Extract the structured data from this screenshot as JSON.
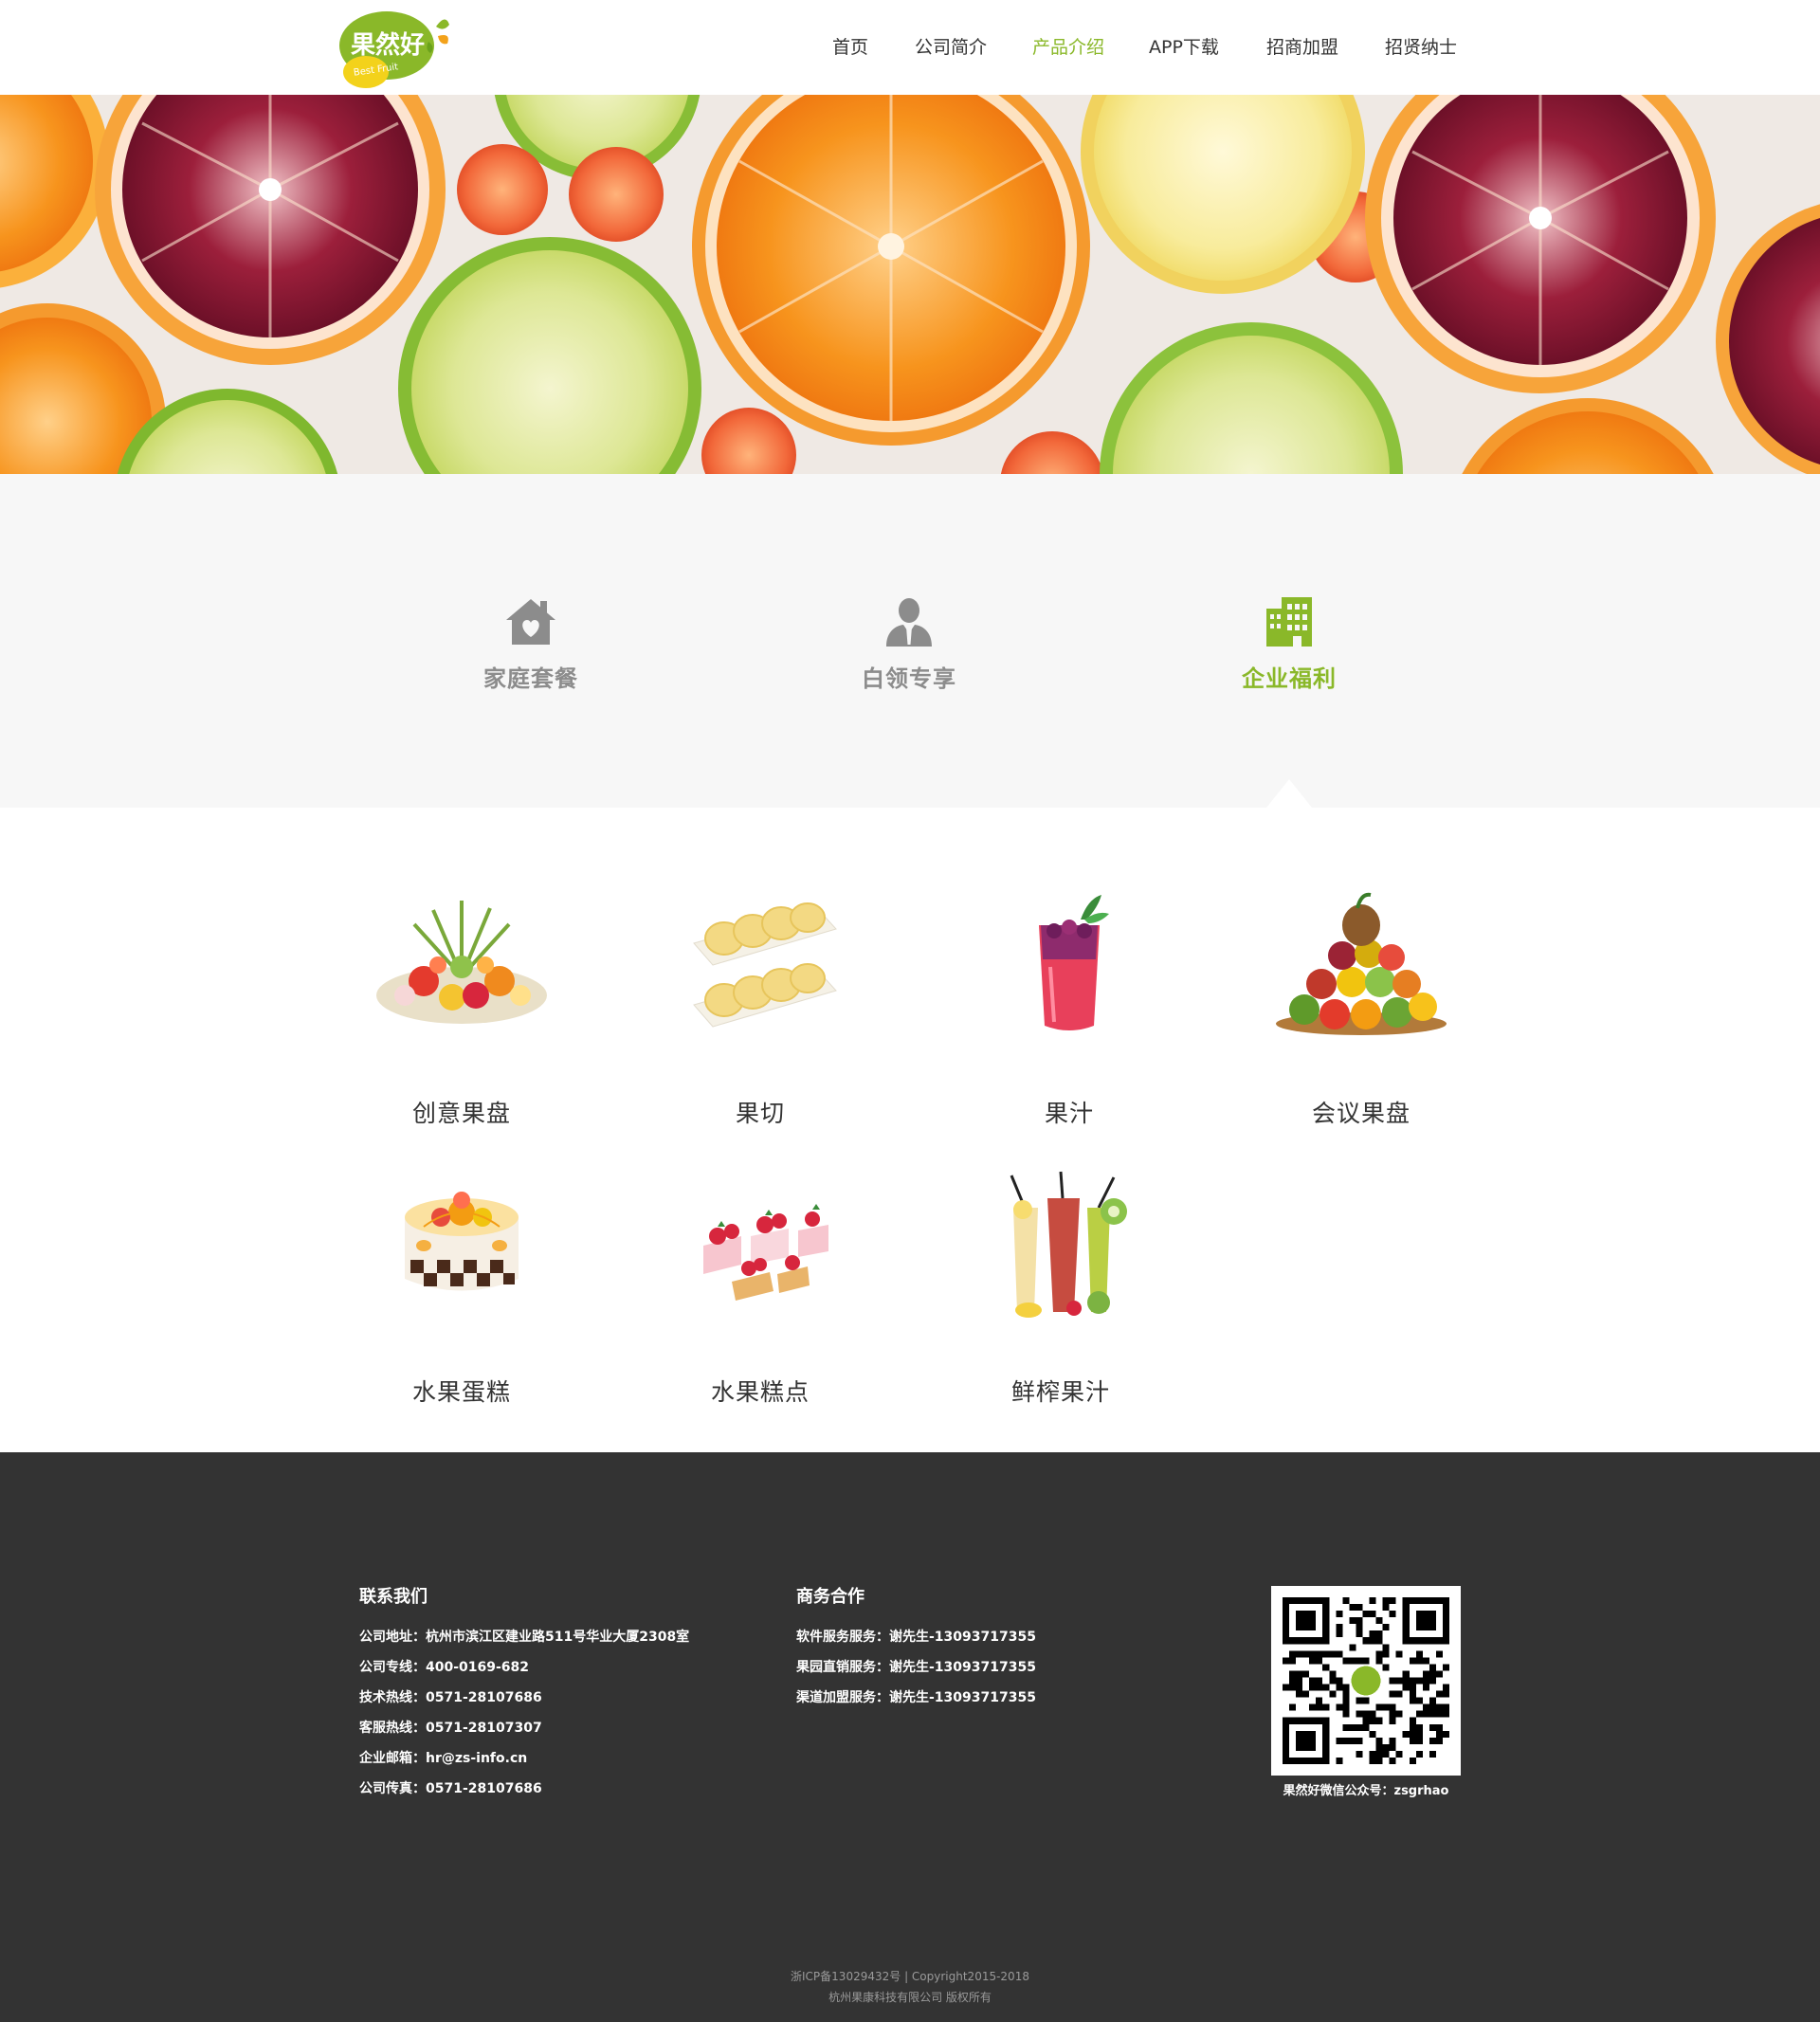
{
  "brand": {
    "logo_text": "果然好",
    "logo_sub": "Best Fruit",
    "accent_color": "#8ab829"
  },
  "nav": {
    "items": [
      {
        "label": "首页",
        "active": false
      },
      {
        "label": "公司简介",
        "active": false
      },
      {
        "label": "产品介绍",
        "active": true
      },
      {
        "label": "APP下载",
        "active": false
      },
      {
        "label": "招商加盟",
        "active": false
      },
      {
        "label": "招贤纳士",
        "active": false
      }
    ]
  },
  "categories": [
    {
      "label": "家庭套餐",
      "icon": "house-heart-icon",
      "active": false
    },
    {
      "label": "白领专享",
      "icon": "person-suit-icon",
      "active": false
    },
    {
      "label": "企业福利",
      "icon": "office-building-icon",
      "active": true
    }
  ],
  "products": [
    {
      "label": "创意果盘",
      "icon": "fruit-platter-icon"
    },
    {
      "label": "果切",
      "icon": "pomelo-slices-icon"
    },
    {
      "label": "果汁",
      "icon": "berry-juice-glass-icon"
    },
    {
      "label": "会议果盘",
      "icon": "fruit-pyramid-icon"
    },
    {
      "label": "水果蛋糕",
      "icon": "fruit-cake-icon"
    },
    {
      "label": "水果糕点",
      "icon": "fruit-pastries-icon"
    },
    {
      "label": "鲜榨果汁",
      "icon": "fresh-juices-icon"
    }
  ],
  "footer": {
    "contact": {
      "title": "联系我们",
      "lines": [
        "公司地址：杭州市滨江区建业路511号华业大厦2308室",
        "公司专线：400-0169-682",
        "技术热线：0571-28107686",
        "客服热线：0571-28107307",
        "企业邮箱：hr@zs-info.cn",
        "公司传真：0571-28107686"
      ]
    },
    "business": {
      "title": "商务合作",
      "lines": [
        "软件服务服务：谢先生-13093717355",
        "果园直销服务：谢先生-13093717355",
        "渠道加盟服务：谢先生-13093717355"
      ]
    },
    "qr_caption": "果然好微信公众号：zsgrhao",
    "icp": "浙ICP备13029432号  |  Copyright2015-2018",
    "company": "杭州果康科技有限公司 版权所有"
  }
}
